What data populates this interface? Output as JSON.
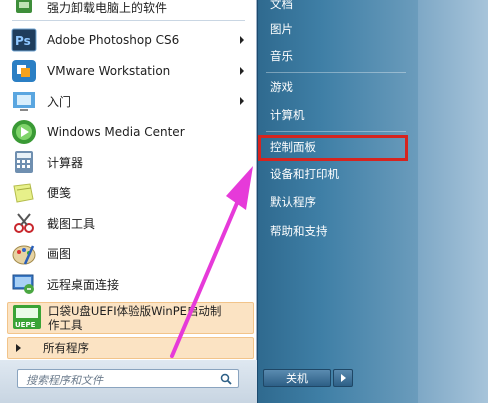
{
  "left": {
    "items": [
      {
        "label": "强力卸载电脑上的软件",
        "icon": "uninstall-icon",
        "submenu": false
      },
      {
        "label": "Adobe Photoshop CS6",
        "icon": "photoshop-icon",
        "submenu": true
      },
      {
        "label": "VMware Workstation",
        "icon": "vmware-icon",
        "submenu": true
      },
      {
        "label": "入门",
        "icon": "getting-started-icon",
        "submenu": true
      },
      {
        "label": "Windows Media Center",
        "icon": "media-center-icon",
        "submenu": false
      },
      {
        "label": "计算器",
        "icon": "calculator-icon",
        "submenu": false
      },
      {
        "label": "便笺",
        "icon": "sticky-notes-icon",
        "submenu": false
      },
      {
        "label": "截图工具",
        "icon": "snipping-tool-icon",
        "submenu": false
      },
      {
        "label": "画图",
        "icon": "paint-icon",
        "submenu": false
      },
      {
        "label": "远程桌面连接",
        "icon": "remote-desktop-icon",
        "submenu": false
      }
    ],
    "highlight": {
      "line1": "口袋U盘UEFI体验版WinPE启动制",
      "line2": "作工具"
    },
    "all_programs": "所有程序",
    "search_placeholder": "搜索程序和文件"
  },
  "right": {
    "items": [
      "文档",
      "图片",
      "音乐",
      "游戏",
      "计算机",
      "控制面板",
      "设备和打印机",
      "默认程序",
      "帮助和支持"
    ],
    "shutdown": "关机"
  },
  "colors": {
    "highlight": "#fbe3c3",
    "red_box": "#d6241f",
    "arrow": "#e63ad9"
  }
}
